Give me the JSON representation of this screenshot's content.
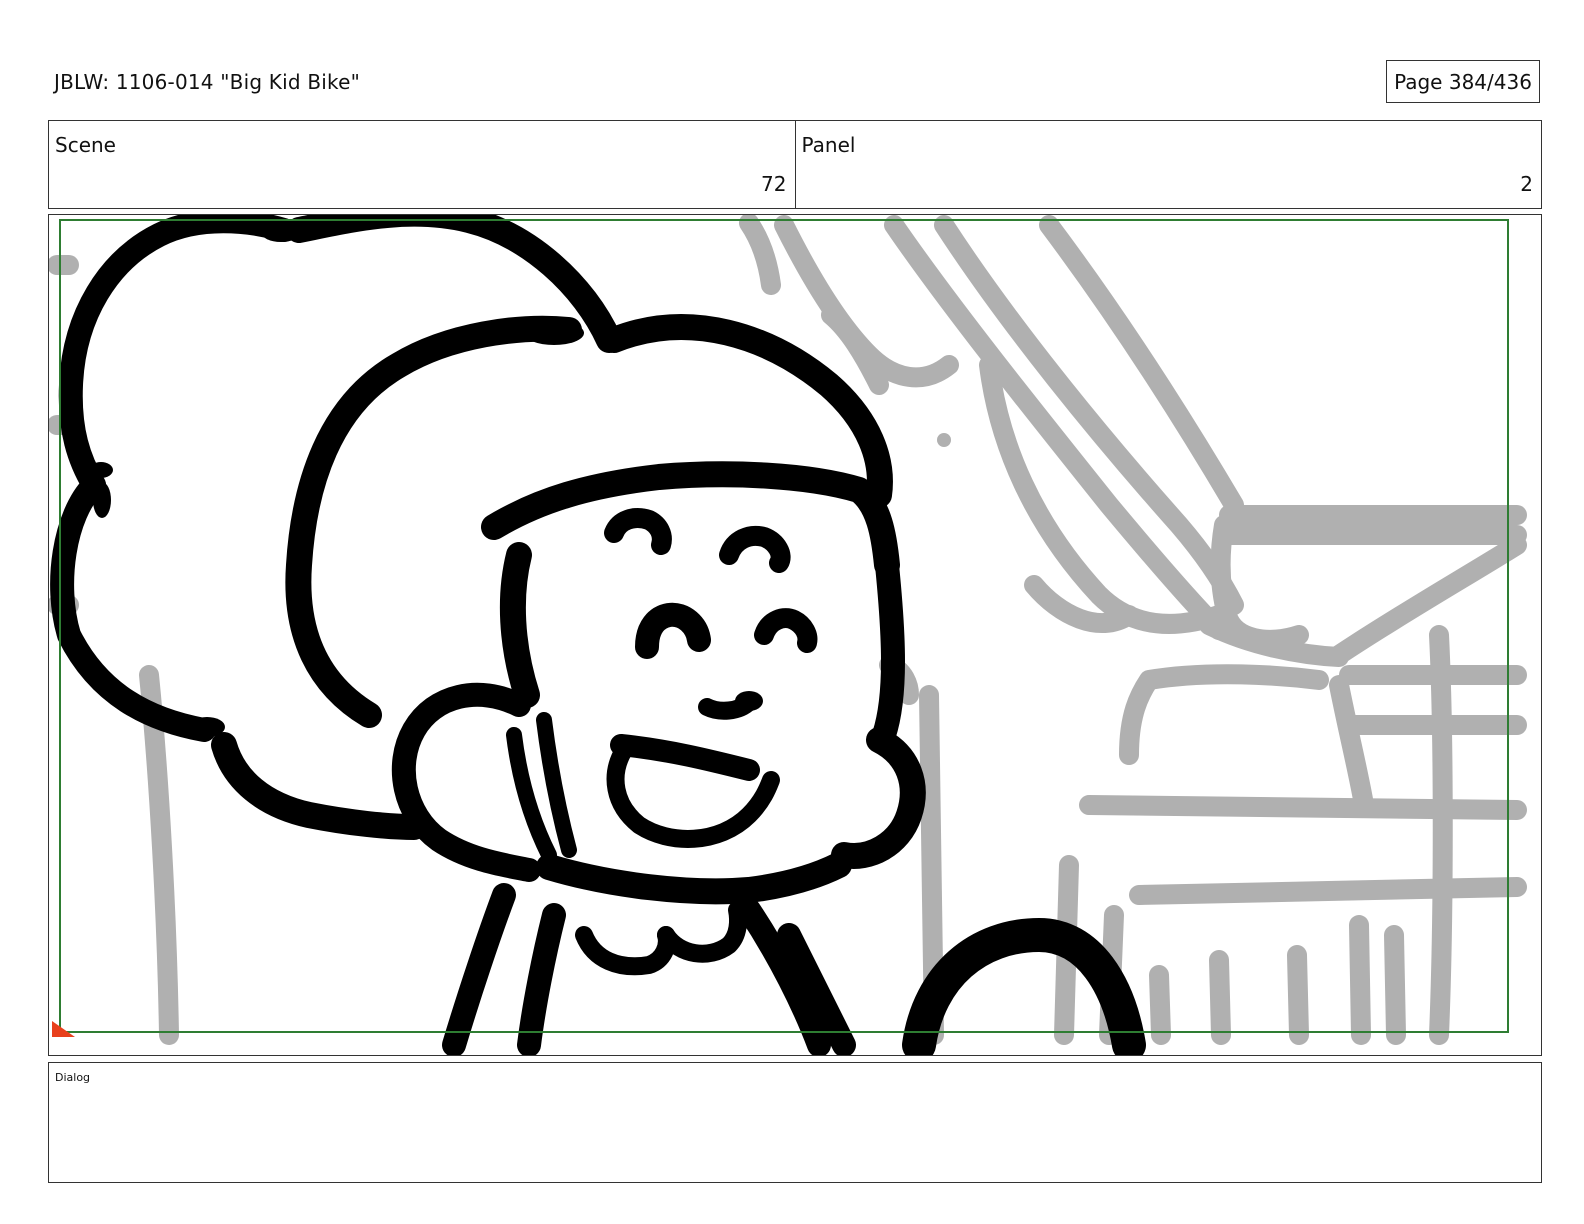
{
  "header": {
    "title": "JBLW: 1106-014 \"Big Kid Bike\"",
    "page": "Page 384/436"
  },
  "info": {
    "scene_label": "Scene",
    "scene_value": "72",
    "panel_label": "Panel",
    "panel_value": "2"
  },
  "dialog": {
    "label": "Dialog"
  },
  "colors": {
    "border": "#333333",
    "safe_frame": "#2e7d32",
    "ink": "#000000",
    "background_sketch": "#b0b0b0",
    "corner_marker": "#e8401c"
  }
}
